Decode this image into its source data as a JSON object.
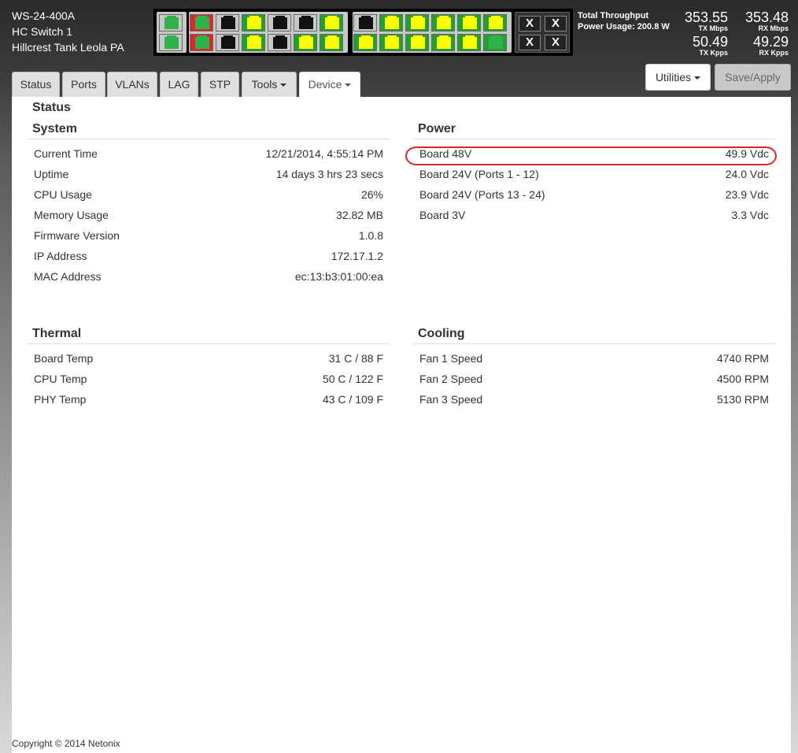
{
  "device": {
    "model": "WS-24-400A",
    "name": "HC Switch 1",
    "location": "Hillcrest Tank Leola PA"
  },
  "throughput": {
    "title": "Total Throughput",
    "power_usage": "Power Usage: 200.8 W",
    "tx_mbps": "353.55",
    "tx_mbps_unit": "TX Mbps",
    "rx_mbps": "353.48",
    "rx_mbps_unit": "RX Mbps",
    "tx_kpps": "50.49",
    "tx_kpps_unit": "TX Kpps",
    "rx_kpps": "49.29",
    "rx_kpps_unit": "RX Kpps"
  },
  "ports": {
    "colors": {
      "green": "#2db34a",
      "yellow": "#ffff00",
      "black": "#111111",
      "red_bg": "#e0262d",
      "grey_bg": "#c8c8c8",
      "green_bg": "#1fa030"
    },
    "x_label": "X"
  },
  "tabs": [
    {
      "label": "Status"
    },
    {
      "label": "Ports"
    },
    {
      "label": "VLANs"
    },
    {
      "label": "LAG"
    },
    {
      "label": "STP"
    },
    {
      "label": "Tools"
    },
    {
      "label": "Device"
    }
  ],
  "buttons": {
    "utilities": "Utilities",
    "save_apply": "Save/Apply"
  },
  "page_title": "Status",
  "system": {
    "title": "System",
    "rows": [
      {
        "label": "Current Time",
        "value": "12/21/2014, 4:55:14 PM"
      },
      {
        "label": "Uptime",
        "value": "14 days 3 hrs 23 secs"
      },
      {
        "label": "CPU Usage",
        "value": "26%"
      },
      {
        "label": "Memory Usage",
        "value": "32.82 MB"
      },
      {
        "label": "Firmware Version",
        "value": "1.0.8"
      },
      {
        "label": "IP Address",
        "value": "172.17.1.2"
      },
      {
        "label": "MAC Address",
        "value": "ec:13:b3:01:00:ea"
      }
    ]
  },
  "power": {
    "title": "Power",
    "rows": [
      {
        "label": "Board 48V",
        "value": "49.9 Vdc"
      },
      {
        "label": "Board 24V (Ports 1 - 12)",
        "value": "24.0 Vdc"
      },
      {
        "label": "Board 24V (Ports 13 - 24)",
        "value": "23.9 Vdc"
      },
      {
        "label": "Board 3V",
        "value": "3.3 Vdc"
      }
    ]
  },
  "thermal": {
    "title": "Thermal",
    "rows": [
      {
        "label": "Board Temp",
        "value": "31 C / 88 F"
      },
      {
        "label": "CPU Temp",
        "value": "50 C / 122 F"
      },
      {
        "label": "PHY Temp",
        "value": "43 C / 109 F"
      }
    ]
  },
  "cooling": {
    "title": "Cooling",
    "rows": [
      {
        "label": "Fan 1 Speed",
        "value": "4740 RPM"
      },
      {
        "label": "Fan 2 Speed",
        "value": "4500 RPM"
      },
      {
        "label": "Fan 3 Speed",
        "value": "5130 RPM"
      }
    ]
  },
  "footer": "Copyright © 2014 Netonix"
}
